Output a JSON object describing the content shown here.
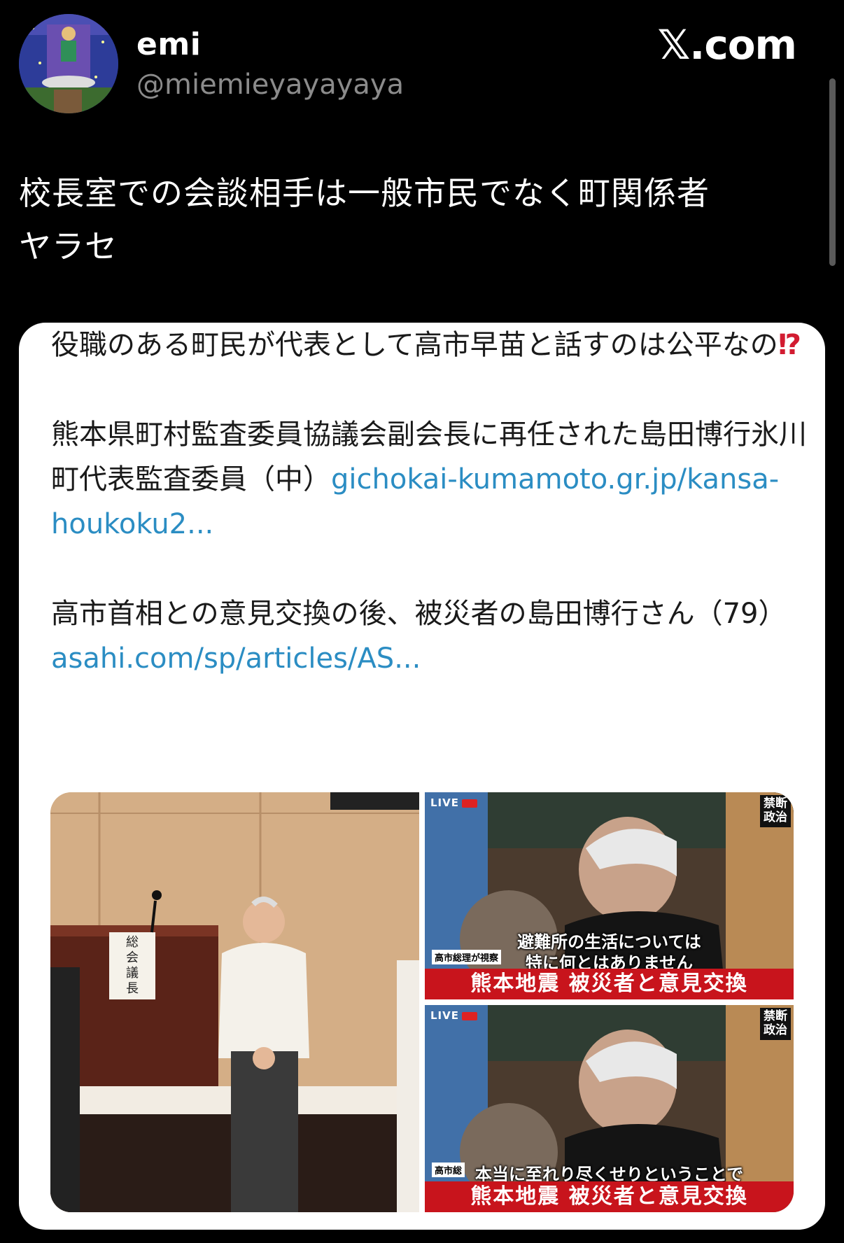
{
  "author": {
    "display_name": "emi",
    "handle": "@miemieyayayaya",
    "avatar_icon": "avatar-illustration"
  },
  "brand": "𝕏.com",
  "tweet": {
    "line1": "校長室での会談相手は一般市民でなく町関係者",
    "line2": "ヤラセ"
  },
  "quoted": {
    "para1_text": "役職のある町民が代表として高市早苗と話すのは公平なの",
    "para1_emoji": "⁉",
    "para2_text": "熊本県町村監査委員協議会副会長に再任された島田博行氷川町代表監査委員（中）",
    "para2_link": "gichokai-kumamoto.gr.jp/kansa-houkoku2...",
    "para3_text": "高市首相との意見交換の後、被災者の島田博行さん（79）",
    "para3_link": "asahi.com/sp/articles/AS...",
    "photo_left_sign": "総会議長",
    "photo_top_right": {
      "live": "LIVE",
      "corner": "禁断政治",
      "small_tag": "高市総理が視察",
      "caption_top1": "避難所の生活については",
      "caption_top2": "特に何とはありません",
      "strip": "熊本地震 被災者と意見交換"
    },
    "photo_bottom_right": {
      "live": "LIVE",
      "corner": "禁断政治",
      "small_tag": "高市総",
      "caption_top1": "本当に至れり尽くせりということで",
      "strip": "熊本地震 被災者と意見交換"
    }
  }
}
